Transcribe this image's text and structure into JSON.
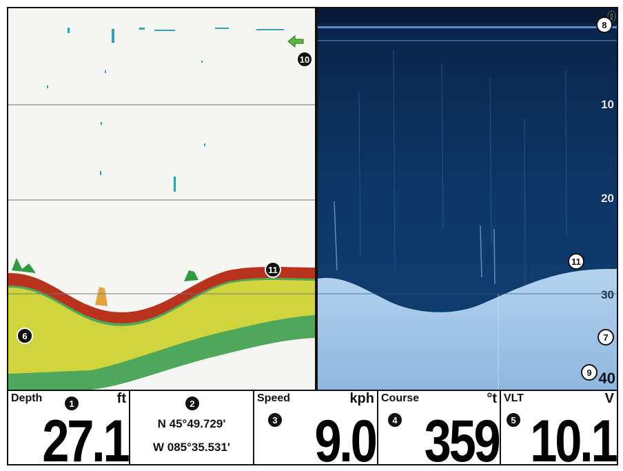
{
  "colors": {
    "sonar_bottom_red": "#b8321c",
    "sonar_yellow": "#e0d93a",
    "sonar_green": "#2f9a3f",
    "sonar_water": "#f5f6f4",
    "imaging_water": "#0b2a52",
    "imaging_bottom": "#9fc3e6"
  },
  "sonar_2d": {
    "callout_fish_arrow": "10",
    "callout_bottom_line": "11",
    "callout_sonar_return": "6",
    "fish_icon": "fish-arrow-icon"
  },
  "imaging": {
    "scale": [
      "0",
      "10",
      "20",
      "30",
      "40"
    ],
    "callout_surface": "8",
    "callout_bottom": "11",
    "callout_bottom_return": "7",
    "callout_max_depth": "9"
  },
  "data_bar": {
    "depth": {
      "label": "Depth",
      "unit": "ft",
      "value": "27.1",
      "callout": "1"
    },
    "position": {
      "lat": "N 45°49.729'",
      "lon": "W 085°35.531'",
      "callout": "2"
    },
    "speed": {
      "label": "Speed",
      "unit": "kph",
      "value": "9.0",
      "callout": "3"
    },
    "course": {
      "label": "Course",
      "unit": "°t",
      "value": "359",
      "callout": "4"
    },
    "voltage": {
      "label": "VLT",
      "unit": "V",
      "value": "10.1",
      "callout": "5"
    }
  }
}
